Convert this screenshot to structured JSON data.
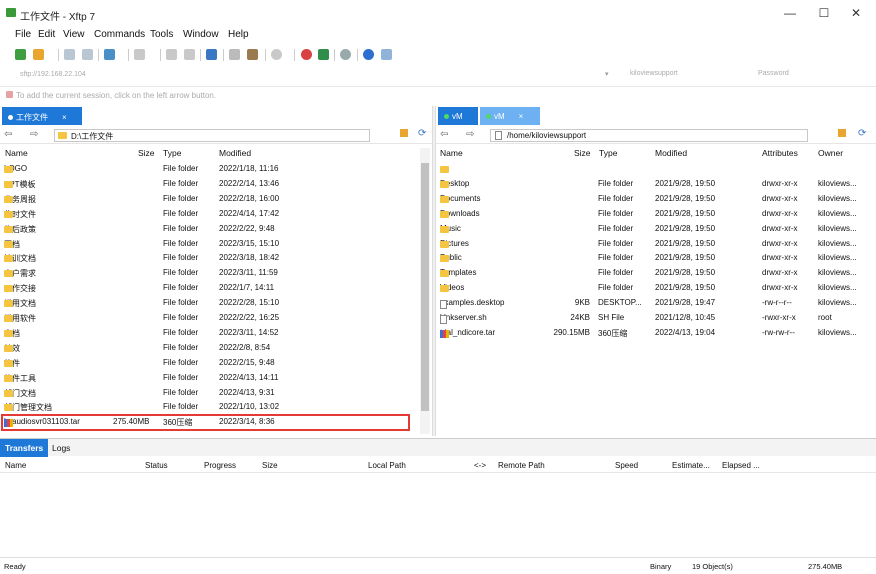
{
  "window": {
    "title": "工作文件 - Xftp 7",
    "minimize": "—",
    "maximize": "☐",
    "close": "✕"
  },
  "menu": [
    "File",
    "Edit",
    "View",
    "Commands",
    "Tools",
    "Window",
    "Help"
  ],
  "address": {
    "host": "sftp://192.168.22.104",
    "user": "kiloviewsupport",
    "password_placeholder": "Password"
  },
  "hint": "To add the current session, click on the left arrow button.",
  "left": {
    "tab": "工作文件",
    "path": "D:\\工作文件",
    "columns": [
      "Name",
      "Size",
      "Type",
      "Modified"
    ],
    "rows": [
      {
        "name": "LOGO",
        "size": "",
        "type": "File folder",
        "modified": "2022/1/18, 11:16",
        "icon": "folder"
      },
      {
        "name": "PPT模板",
        "size": "",
        "type": "File folder",
        "modified": "2022/2/14, 13:46",
        "icon": "folder"
      },
      {
        "name": "业务周报",
        "size": "",
        "type": "File folder",
        "modified": "2022/2/18, 16:00",
        "icon": "folder"
      },
      {
        "name": "临时文件",
        "size": "",
        "type": "File folder",
        "modified": "2022/4/14, 17:42",
        "icon": "folder"
      },
      {
        "name": "售后政策",
        "size": "",
        "type": "File folder",
        "modified": "2022/2/22, 9:48",
        "icon": "folder"
      },
      {
        "name": "图档",
        "size": "",
        "type": "File folder",
        "modified": "2022/3/15, 15:10",
        "icon": "folder"
      },
      {
        "name": "培训文档",
        "size": "",
        "type": "File folder",
        "modified": "2022/3/18, 18:42",
        "icon": "folder"
      },
      {
        "name": "客户需求",
        "size": "",
        "type": "File folder",
        "modified": "2022/3/11, 11:59",
        "icon": "folder"
      },
      {
        "name": "工作交接",
        "size": "",
        "type": "File folder",
        "modified": "2022/1/7, 14:11",
        "icon": "folder"
      },
      {
        "name": "常用文档",
        "size": "",
        "type": "File folder",
        "modified": "2022/2/28, 15:10",
        "icon": "folder"
      },
      {
        "name": "常用软件",
        "size": "",
        "type": "File folder",
        "modified": "2022/2/22, 16:25",
        "icon": "folder"
      },
      {
        "name": "文档",
        "size": "",
        "type": "File folder",
        "modified": "2022/3/11, 14:52",
        "icon": "folder"
      },
      {
        "name": "绩效",
        "size": "",
        "type": "File folder",
        "modified": "2022/2/8, 8:54",
        "icon": "folder"
      },
      {
        "name": "软件",
        "size": "",
        "type": "File folder",
        "modified": "2022/2/15, 9:48",
        "icon": "folder"
      },
      {
        "name": "软件工具",
        "size": "",
        "type": "File folder",
        "modified": "2022/4/13, 14:11",
        "icon": "folder"
      },
      {
        "name": "部门文档",
        "size": "",
        "type": "File folder",
        "modified": "2022/4/13, 9:31",
        "icon": "folder"
      },
      {
        "name": "部门管理文档",
        "size": "",
        "type": "File folder",
        "modified": "2022/1/10, 13:02",
        "icon": "folder"
      },
      {
        "name": "kvaudiosvr031103.tar",
        "size": "275.40MB",
        "type": "360压缩",
        "modified": "2022/3/14, 8:36",
        "icon": "archive"
      }
    ]
  },
  "right": {
    "tabs": [
      "vM",
      "vM"
    ],
    "path": "/home/kiloviewsupport",
    "columns": [
      "Name",
      "Size",
      "Type",
      "Modified",
      "Attributes",
      "Owner"
    ],
    "rows": [
      {
        "name": "..",
        "size": "",
        "type": "",
        "modified": "",
        "attr": "",
        "owner": "",
        "icon": "folder"
      },
      {
        "name": "Desktop",
        "size": "",
        "type": "File folder",
        "modified": "2021/9/28, 19:50",
        "attr": "drwxr-xr-x",
        "owner": "kiloviews...",
        "icon": "folder"
      },
      {
        "name": "Documents",
        "size": "",
        "type": "File folder",
        "modified": "2021/9/28, 19:50",
        "attr": "drwxr-xr-x",
        "owner": "kiloviews...",
        "icon": "folder"
      },
      {
        "name": "Downloads",
        "size": "",
        "type": "File folder",
        "modified": "2021/9/28, 19:50",
        "attr": "drwxr-xr-x",
        "owner": "kiloviews...",
        "icon": "folder"
      },
      {
        "name": "Music",
        "size": "",
        "type": "File folder",
        "modified": "2021/9/28, 19:50",
        "attr": "drwxr-xr-x",
        "owner": "kiloviews...",
        "icon": "folder"
      },
      {
        "name": "Pictures",
        "size": "",
        "type": "File folder",
        "modified": "2021/9/28, 19:50",
        "attr": "drwxr-xr-x",
        "owner": "kiloviews...",
        "icon": "folder"
      },
      {
        "name": "Public",
        "size": "",
        "type": "File folder",
        "modified": "2021/9/28, 19:50",
        "attr": "drwxr-xr-x",
        "owner": "kiloviews...",
        "icon": "folder"
      },
      {
        "name": "Templates",
        "size": "",
        "type": "File folder",
        "modified": "2021/9/28, 19:50",
        "attr": "drwxr-xr-x",
        "owner": "kiloviews...",
        "icon": "folder"
      },
      {
        "name": "Videos",
        "size": "",
        "type": "File folder",
        "modified": "2021/9/28, 19:50",
        "attr": "drwxr-xr-x",
        "owner": "kiloviews...",
        "icon": "folder"
      },
      {
        "name": "examples.desktop",
        "size": "9KB",
        "type": "DESKTOP...",
        "modified": "2021/9/28, 19:47",
        "attr": "-rw-r--r--",
        "owner": "kiloviews...",
        "icon": "file"
      },
      {
        "name": "klnkserver.sh",
        "size": "24KB",
        "type": "SH File",
        "modified": "2021/12/8, 10:45",
        "attr": "-rwxr-xr-x",
        "owner": "root",
        "icon": "file"
      },
      {
        "name": "trial_ndicore.tar",
        "size": "290.15MB",
        "type": "360压缩",
        "modified": "2022/4/13, 19:04",
        "attr": "-rw-rw-r--",
        "owner": "kiloviews...",
        "icon": "archive"
      }
    ]
  },
  "transfers": {
    "tabs": [
      "Transfers",
      "Logs"
    ],
    "columns": [
      "Name",
      "Status",
      "Progress",
      "Size",
      "Local Path",
      "<->",
      "Remote Path",
      "Speed",
      "Estimate...",
      "Elapsed ..."
    ]
  },
  "status": {
    "left": "Ready",
    "mode": "Binary",
    "objects": "19 Object(s)",
    "size": "275.40MB"
  },
  "colors": {
    "tab_active": "#1e78d7",
    "tab_inactive": "#6db1f2",
    "selection_border": "#e53935"
  }
}
